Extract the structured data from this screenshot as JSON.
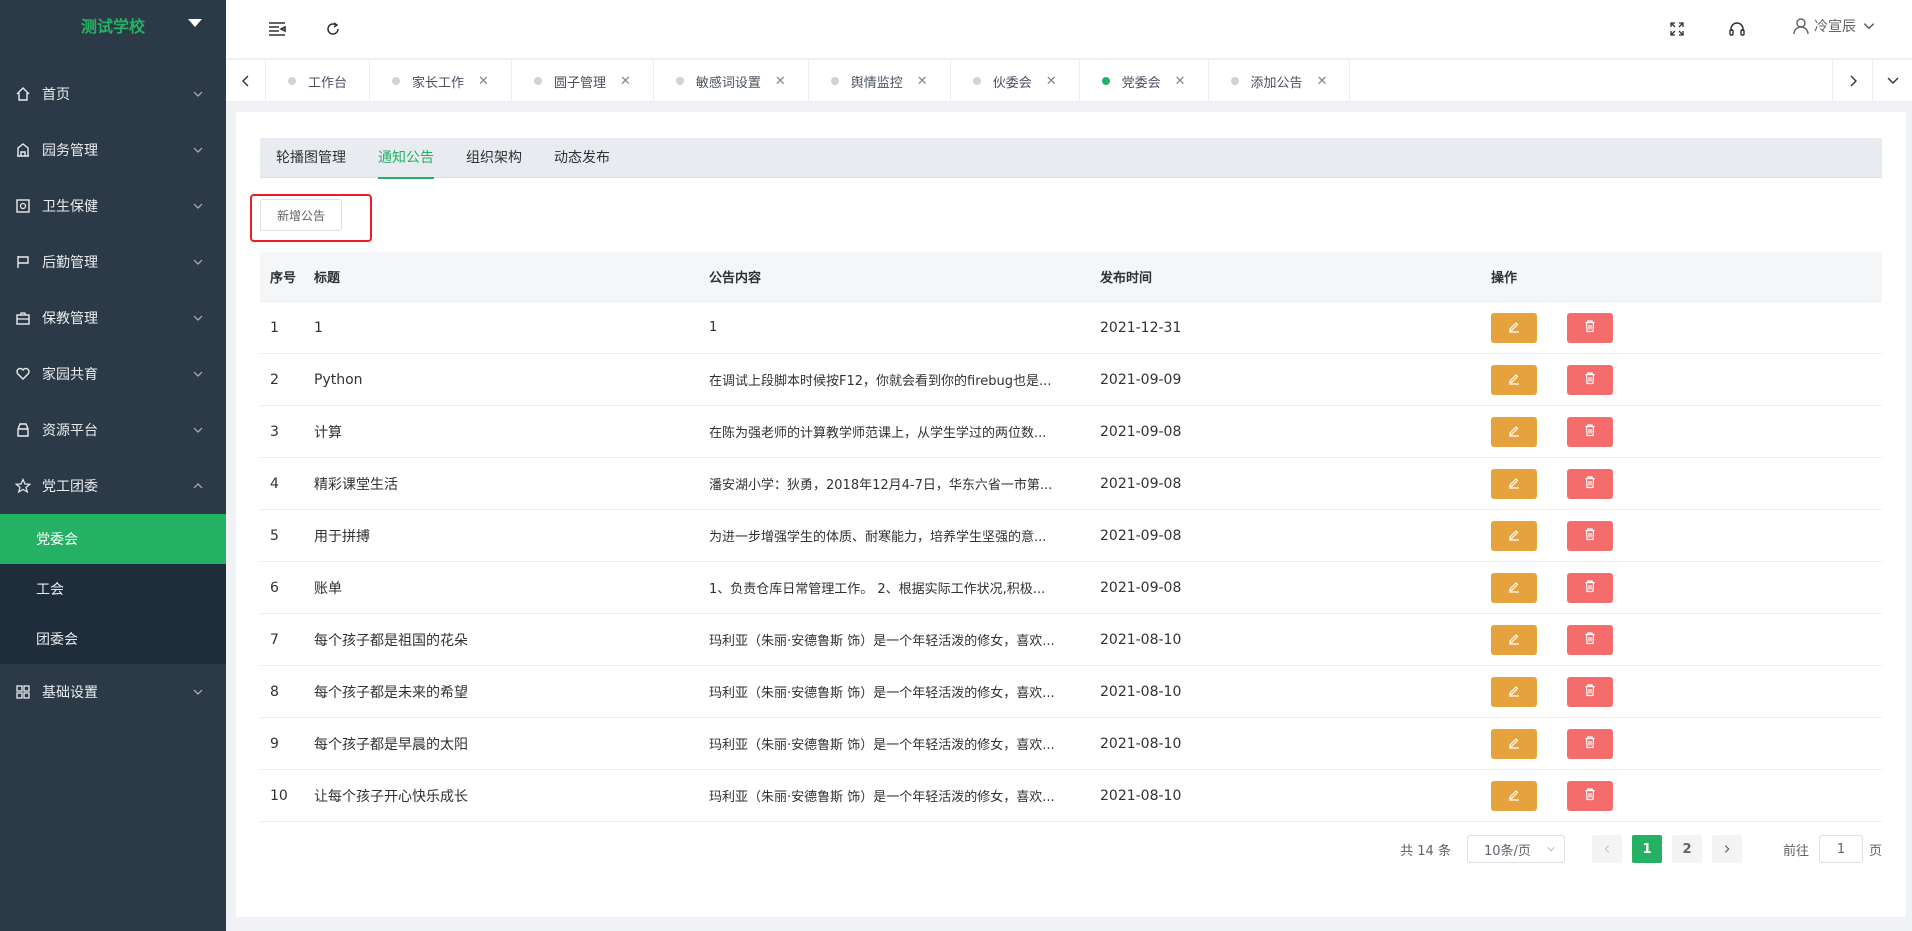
{
  "sidebar": {
    "brand": "测试学校",
    "menu": [
      {
        "label": "首页",
        "icon": "home-icon"
      },
      {
        "label": "园务管理",
        "icon": "building-icon"
      },
      {
        "label": "卫生保健",
        "icon": "health-icon"
      },
      {
        "label": "后勤管理",
        "icon": "calendar-icon"
      },
      {
        "label": "保教管理",
        "icon": "briefcase-icon"
      },
      {
        "label": "家园共育",
        "icon": "heart-icon"
      },
      {
        "label": "资源平台",
        "icon": "archive-icon"
      },
      {
        "label": "党工团委",
        "icon": "star-icon"
      }
    ],
    "submenu": [
      {
        "label": "党委会",
        "active": true
      },
      {
        "label": "工会"
      },
      {
        "label": "团委会"
      }
    ],
    "last_menu": {
      "label": "基础设置",
      "icon": "grid-icon"
    }
  },
  "header": {
    "user_name": "冷宣辰"
  },
  "tabs": [
    {
      "label": "工作台",
      "closable": false
    },
    {
      "label": "家长工作",
      "closable": true
    },
    {
      "label": "圆子管理",
      "closable": true
    },
    {
      "label": "敏感词设置",
      "closable": true
    },
    {
      "label": "舆情监控",
      "closable": true
    },
    {
      "label": "伙委会",
      "closable": true
    },
    {
      "label": "党委会",
      "closable": true,
      "active": true
    },
    {
      "label": "添加公告",
      "closable": true
    }
  ],
  "subtabs": [
    "轮播图管理",
    "通知公告",
    "组织架构",
    "动态发布"
  ],
  "add_button": "新增公告",
  "table": {
    "headers": [
      "序号",
      "标题",
      "公告内容",
      "发布时间",
      "操作"
    ],
    "rows": [
      {
        "idx": "1",
        "title": "1",
        "content": "1",
        "date": "2021-12-31"
      },
      {
        "idx": "2",
        "title": "Python",
        "content": "在调试上段脚本时候按F12，你就会看到你的firebug也是...",
        "date": "2021-09-09"
      },
      {
        "idx": "3",
        "title": "计算",
        "content": "在陈为强老师的计算教学师范课上，从学生学过的两位数...",
        "date": "2021-09-08"
      },
      {
        "idx": "4",
        "title": "精彩课堂生活",
        "content": "潘安湖小学：狄勇，2018年12月4-7日，华东六省一市第...",
        "date": "2021-09-08"
      },
      {
        "idx": "5",
        "title": "用于拼搏",
        "content": "为进一步增强学生的体质、耐寒能力，培养学生坚强的意...",
        "date": "2021-09-08"
      },
      {
        "idx": "6",
        "title": "账单",
        "content": "1、负责仓库日常管理工作。 2、根据实际工作状况,积极...",
        "date": "2021-09-08"
      },
      {
        "idx": "7",
        "title": "每个孩子都是祖国的花朵",
        "content": "玛利亚（朱丽·安德鲁斯 饰）是一个年轻活泼的修女，喜欢...",
        "date": "2021-08-10"
      },
      {
        "idx": "8",
        "title": "每个孩子都是未来的希望",
        "content": "玛利亚（朱丽·安德鲁斯 饰）是一个年轻活泼的修女，喜欢...",
        "date": "2021-08-10"
      },
      {
        "idx": "9",
        "title": "每个孩子都是早晨的太阳",
        "content": "玛利亚（朱丽·安德鲁斯 饰）是一个年轻活泼的修女，喜欢...",
        "date": "2021-08-10"
      },
      {
        "idx": "10",
        "title": "让每个孩子开心快乐成长",
        "content": "玛利亚（朱丽·安德鲁斯 饰）是一个年轻活泼的修女，喜欢...",
        "date": "2021-08-10"
      }
    ]
  },
  "pagination": {
    "total": "共 14 条",
    "page_size": "10条/页",
    "pages": [
      "1",
      "2"
    ],
    "current": "1",
    "goto_prefix": "前往",
    "goto_value": "1",
    "goto_suffix": "页"
  },
  "colors": {
    "brand": "#25b164",
    "sidebar_bg": "#2b3a46",
    "edit": "#e6a23c",
    "delete": "#f56c6c",
    "highlight": "#ec1c24"
  }
}
